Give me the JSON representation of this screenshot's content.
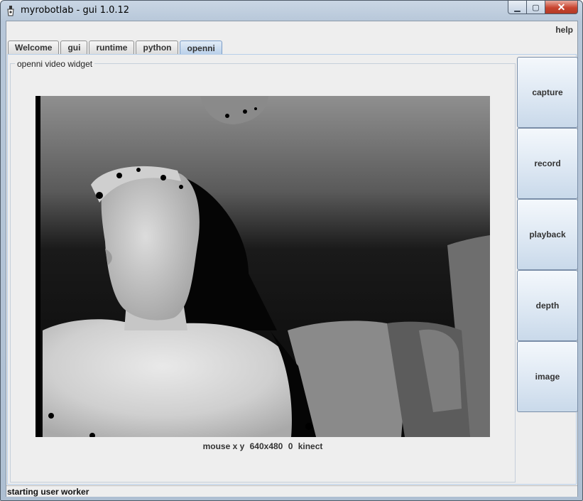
{
  "window": {
    "title": "myrobotlab - gui 1.0.12",
    "controls": {
      "minimize": "▁",
      "maximize": "▢",
      "close": "✕"
    }
  },
  "menubar": {
    "help_label": "help"
  },
  "tabs": [
    {
      "label": "Welcome"
    },
    {
      "label": "gui"
    },
    {
      "label": "runtime"
    },
    {
      "label": "python"
    },
    {
      "label": "openni",
      "active": true
    }
  ],
  "panel": {
    "group_title": "openni  video widget",
    "mouse": {
      "label": "mouse x y",
      "resolution": "640x480",
      "frame": "0",
      "source": "kinect"
    }
  },
  "buttons": [
    {
      "label": "capture"
    },
    {
      "label": "record"
    },
    {
      "label": "playback"
    },
    {
      "label": "depth"
    },
    {
      "label": "image"
    }
  ],
  "statusbar": {
    "text": "starting user worker"
  }
}
